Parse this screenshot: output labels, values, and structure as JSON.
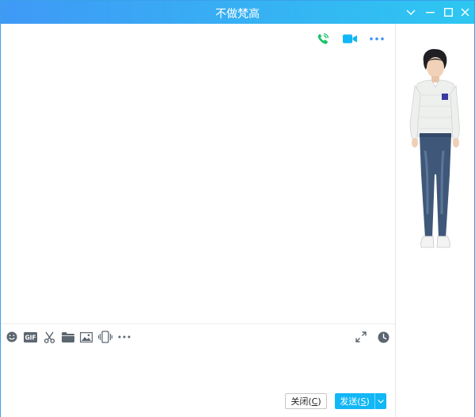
{
  "window": {
    "title": "不做梵高"
  },
  "toolbar": {
    "icons": [
      "emoji-icon",
      "gif-icon",
      "screenshot-scissors-icon",
      "folder-icon",
      "image-icon",
      "shake-window-icon",
      "more-icon"
    ],
    "right_icons": [
      "expand-icon",
      "history-clock-icon"
    ]
  },
  "actions": {
    "close_label": "关闭(",
    "close_hotkey": "C",
    "close_suffix": ")",
    "send_label": "发送(",
    "send_hotkey": "S",
    "send_suffix": ")"
  },
  "colors": {
    "titlebar_start": "#3f99f6",
    "titlebar_end": "#2dc7f1",
    "accent": "#12b7f5",
    "call_green": "#1cc36a"
  }
}
